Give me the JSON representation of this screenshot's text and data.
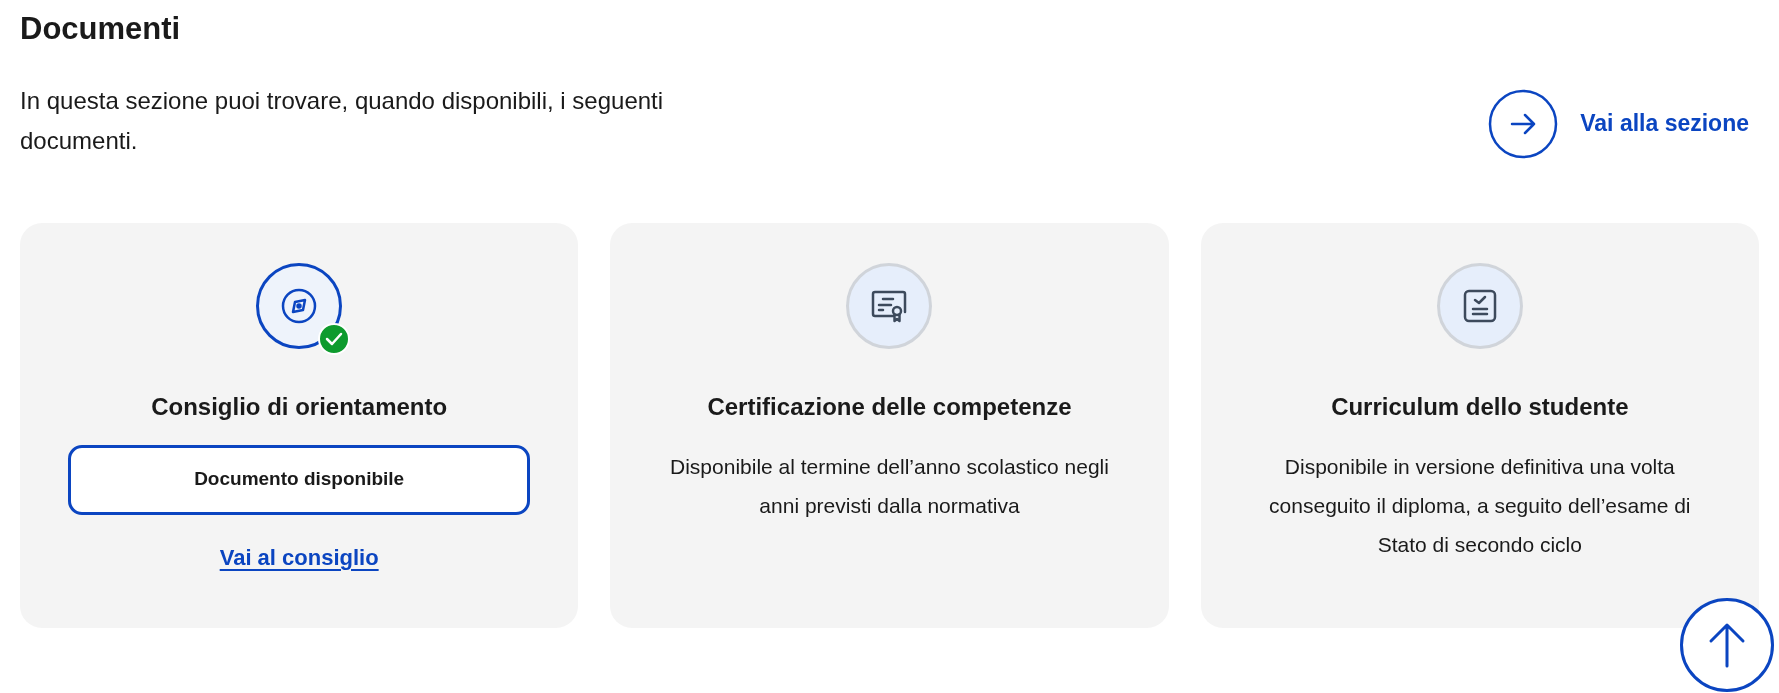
{
  "heading": "Documenti",
  "intro": "In questa sezione puoi trovare, quando disponibili, i seguenti documenti.",
  "section_link": {
    "label": "Vai alla sezione"
  },
  "cards": [
    {
      "kind": "available",
      "title": "Consiglio di orientamento",
      "checked": true,
      "button": "Documento disponibile",
      "link": "Vai al consiglio"
    },
    {
      "kind": "info",
      "title": "Certificazione delle competenze",
      "checked": false,
      "description": "Disponibile al termine dell’anno scolastico negli anni previsti dalla normativa"
    },
    {
      "kind": "info",
      "title": "Curriculum dello studente",
      "checked": false,
      "description": "Disponibile in versione definitiva una volta conseguito il diploma, a seguito dell’esame di Stato di secondo ciclo"
    }
  ]
}
